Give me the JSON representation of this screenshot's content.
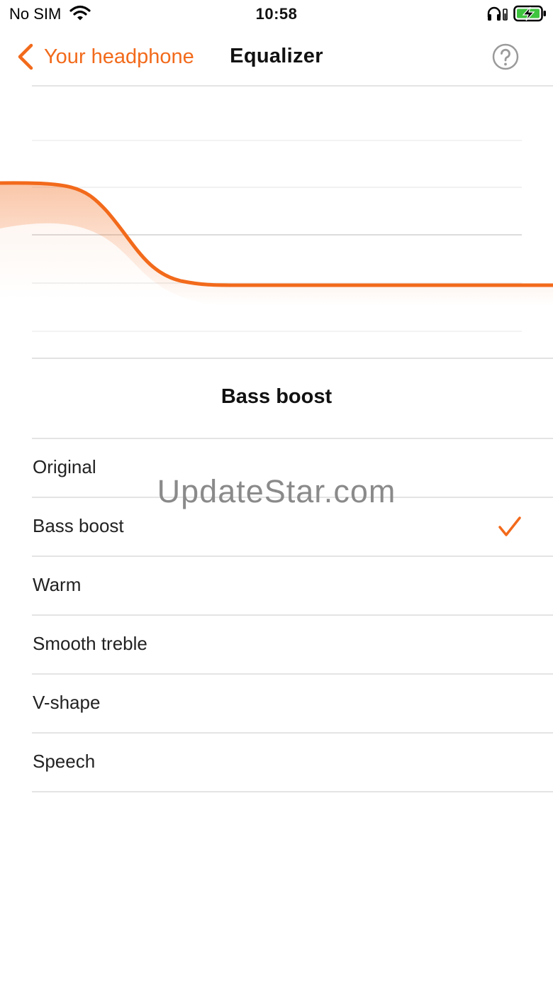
{
  "status_bar": {
    "carrier": "No SIM",
    "time": "10:58",
    "icons": [
      "wifi-icon",
      "headphone-icon",
      "battery-charging-icon"
    ]
  },
  "nav": {
    "back_label": "Your headphone",
    "title": "Equalizer",
    "help_icon": "question-circle-icon"
  },
  "equalizer": {
    "curve_color": "#f26a1b",
    "current_preset": "Bass boost"
  },
  "presets": [
    {
      "label": "Original",
      "selected": false
    },
    {
      "label": "Bass boost",
      "selected": true
    },
    {
      "label": "Warm",
      "selected": false
    },
    {
      "label": "Smooth treble",
      "selected": false
    },
    {
      "label": "V-shape",
      "selected": false
    },
    {
      "label": "Speech",
      "selected": false
    }
  ],
  "watermark": "UpdateStar.com",
  "colors": {
    "accent": "#f26a1b",
    "divider": "#e4e4e4"
  }
}
